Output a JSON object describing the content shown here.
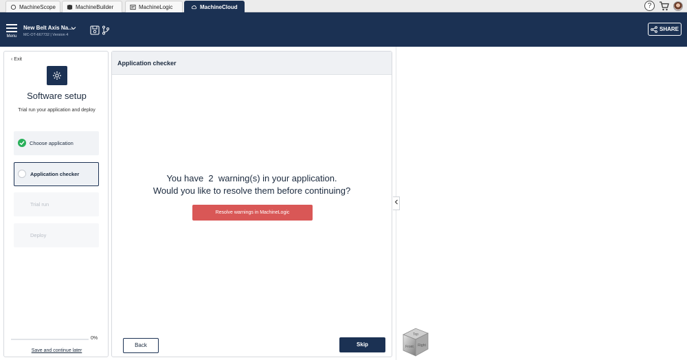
{
  "tabs": [
    {
      "label": "MachineScope",
      "icon": "scope-icon"
    },
    {
      "label": "MachineBuilder",
      "icon": "builder-icon"
    },
    {
      "label": "MachineLogic",
      "icon": "logic-icon"
    },
    {
      "label": "MachineCloud",
      "icon": "cloud-icon",
      "active": true
    }
  ],
  "header": {
    "menu_label": "Menu",
    "project_name": "New Belt Axis Na...",
    "project_sub": "MC-OT-667732 | Version 4",
    "share_label": "SHARE"
  },
  "left": {
    "exit_label": "‹ Exit",
    "title": "Software setup",
    "description": "Trial run your application and deploy",
    "steps": [
      {
        "label": "Choose application",
        "state": "done"
      },
      {
        "label": "Application checker",
        "state": "current"
      },
      {
        "label": "Trial run",
        "state": "disabled"
      },
      {
        "label": "Deploy",
        "state": "disabled"
      }
    ],
    "progress_text": "0%",
    "progress_value": 0,
    "save_label": "Save and continue later"
  },
  "main": {
    "header_title": "Application checker",
    "warning_line1": "You have  2  warning(s) in your application.",
    "warning_line2": "Would you like to resolve them before continuing?",
    "resolve_label": "Resolve warnings in MachineLogic",
    "back_label": "Back",
    "skip_label": "Skip"
  },
  "view_cube": {
    "face_top": "Top",
    "face_right": "Right",
    "face_front": "Front"
  },
  "colors": {
    "navy": "#1b3153",
    "success": "#29b05a",
    "danger": "#d95756"
  }
}
